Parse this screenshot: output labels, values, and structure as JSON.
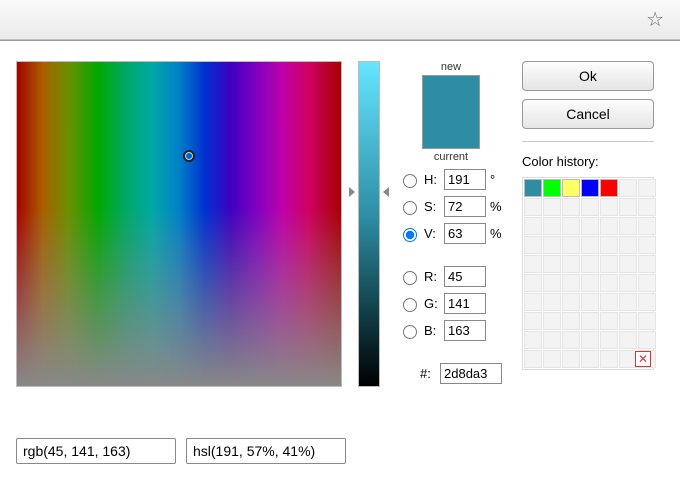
{
  "color": {
    "new_hex": "#2d8da3",
    "current_hex": "#2d8da3",
    "new_label": "new",
    "current_label": "current",
    "H": "191",
    "S": "72",
    "V": "63",
    "R": "45",
    "G": "141",
    "B": "163",
    "hex": "2d8da3",
    "selected_mode": "V",
    "rgb_string": "rgb(45, 141, 163)",
    "hsl_string": "hsl(191, 57%, 41%)"
  },
  "labels": {
    "H": "H:",
    "S": "S:",
    "V": "V:",
    "R": "R:",
    "G": "G:",
    "B": "B:",
    "hash": "#:",
    "deg": "°",
    "pct": "%"
  },
  "buttons": {
    "ok": "Ok",
    "cancel": "Cancel"
  },
  "history": {
    "label": "Color history:",
    "swatches": [
      "#2d8da3",
      "#00ff00",
      "#ffff66",
      "#0000ff",
      "#ff0000"
    ]
  }
}
